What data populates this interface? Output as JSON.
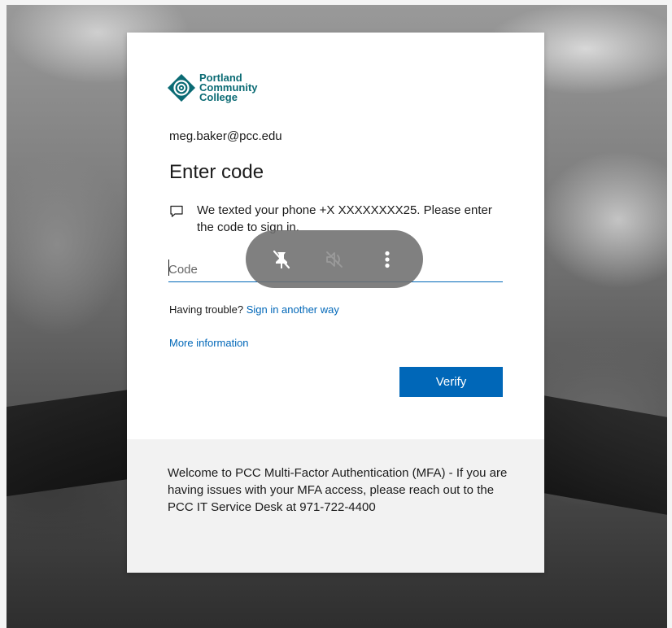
{
  "logo": {
    "line1": "Portland",
    "line2": "Community",
    "line3": "College",
    "color": "#0b6b74"
  },
  "account": {
    "email": "meg.baker@pcc.edu"
  },
  "main": {
    "title": "Enter code",
    "message": "We texted your phone +X XXXXXXXX25. Please enter the code to sign in.",
    "code_input": {
      "placeholder": "Code",
      "value": ""
    },
    "trouble_prefix": "Having trouble?",
    "trouble_link": "Sign in another way",
    "more_info_link": "More information",
    "verify_label": "Verify"
  },
  "footer": {
    "text": "Welcome to PCC Multi-Factor Authentication (MFA) - If you are having issues with your MFA access, please reach out to the PCC IT Service Desk at 971-722-4400"
  },
  "floating_toolbar": {
    "icons": [
      "unpin-icon",
      "mute-icon",
      "more-options-icon"
    ]
  },
  "colors": {
    "accent": "#0067b8",
    "footer_bg": "#f2f2f2"
  }
}
